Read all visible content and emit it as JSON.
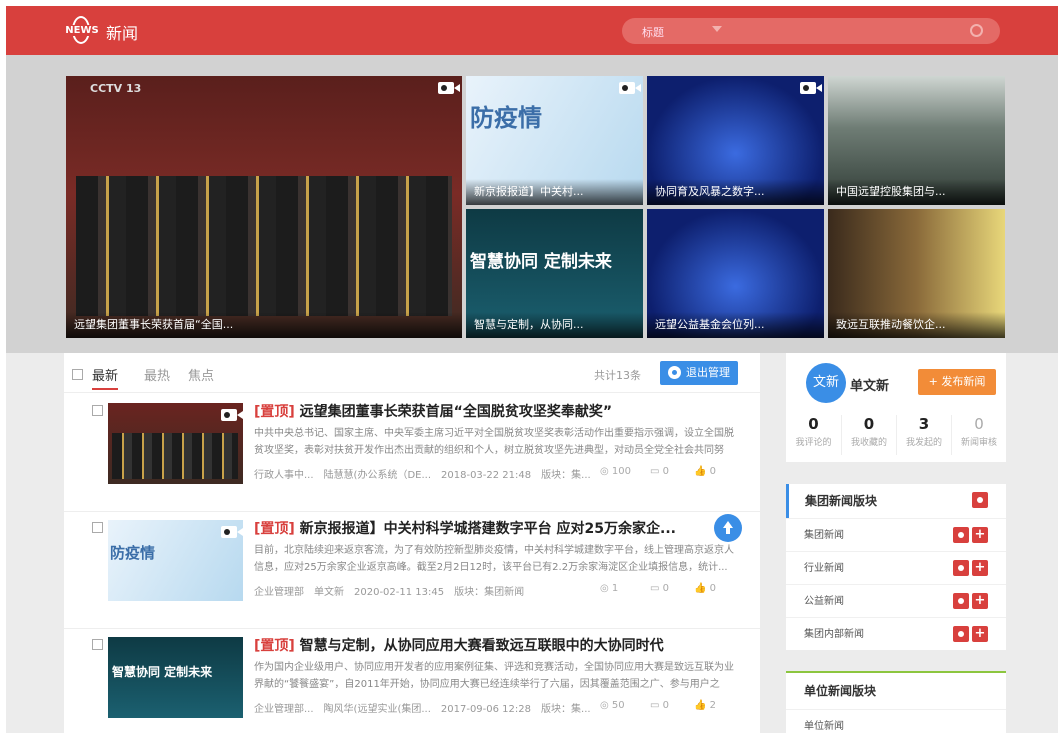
{
  "header": {
    "logo": "NEWS",
    "title": "新闻",
    "search_select": "标题"
  },
  "banner": {
    "captions": [
      "远望集团董事长荣获首届“全国...",
      "新京报报道】中关村...",
      "协同育及风暴之数字...",
      "中国远望控股集团与...",
      "智慧与定制，从协同...",
      "远望公益基金会位列...",
      "致远互联推动餐饮企..."
    ],
    "texts": {
      "cctv": "CCTV 13",
      "epidemic": "防疫情",
      "wisdom": "智慧协同 定制未来"
    }
  },
  "list": {
    "tabs": [
      "最新",
      "最热",
      "焦点"
    ],
    "total": "共计13条",
    "exit_label": "退出管理",
    "items": [
      {
        "pin": "[置顶]",
        "title": "远望集团董事长荣获首届“全国脱贫攻坚奖奉献奖”",
        "summary": "中共中央总书记、国家主席、中央军委主席习近平对全国脱贫攻坚奖表彰活动作出重要指示强调，设立全国脱贫攻坚奖，表彰对扶贫开发作出杰出贡献的组织和个人，树立脱贫攻坚先进典型，对动员全党全社会共同努力、打赢",
        "dept": "行政人事中...",
        "author": "陆慧慧(办公系统（DE...",
        "time": "2018-03-22 21:48",
        "board": "版块：集...",
        "views": "100",
        "comments": "0",
        "likes": "0"
      },
      {
        "pin": "[置顶]",
        "title": "新京报报道】中关村科学城搭建数字平台 应对25万余家企...",
        "summary": "目前，北京陆续迎来返京客流，为了有效防控新型肺炎疫情，中关村科学城建数字平台，线上管理高京返京人信息，应对25万余家企业返京高峰。截至2月2日12时，该平台已有2.2万余家海淀区企业填报信息，统计...",
        "dept": "企业管理部",
        "author": "单文新",
        "time": "2020-02-11 13:45",
        "board": "版块：集团新闻",
        "views": "1",
        "comments": "0",
        "likes": "0"
      },
      {
        "pin": "[置顶]",
        "title": "智慧与定制，从协同应用大赛看致远互联眼中的大协同时代",
        "summary": "作为国内企业级用户、协同应用开发者的应用案例征集、评选和竞赛活动，全国协同应用大赛是致远互联为业界献的“饕餮盛宴”，自2011年开始，协同应用大赛已经连续举行了六届，因其覆盖范围之广、参与用户之多、...",
        "dept": "企业管理部...",
        "author": "陶风华(远望实业(集团...",
        "time": "2017-09-06 12:28",
        "board": "版块：集...",
        "views": "50",
        "comments": "0",
        "likes": "2"
      }
    ]
  },
  "user": {
    "avatar": "文新",
    "name": "单文新",
    "publish": "+ 发布新闻",
    "counts": [
      {
        "n": "0",
        "l": "我评论的"
      },
      {
        "n": "0",
        "l": "我收藏的"
      },
      {
        "n": "3",
        "l": "我发起的"
      },
      {
        "n": "0",
        "l": "新闻审核"
      }
    ]
  },
  "group_section": {
    "title": "集团新闻版块",
    "rows": [
      "集团新闻",
      "行业新闻",
      "公益新闻",
      "集团内部新闻"
    ]
  },
  "unit_section": {
    "title": "单位新闻版块",
    "rows": [
      "单位新闻"
    ]
  },
  "colors": {
    "red": "#d8403d",
    "blue": "#3a8ee6",
    "orange": "#f28c38"
  }
}
